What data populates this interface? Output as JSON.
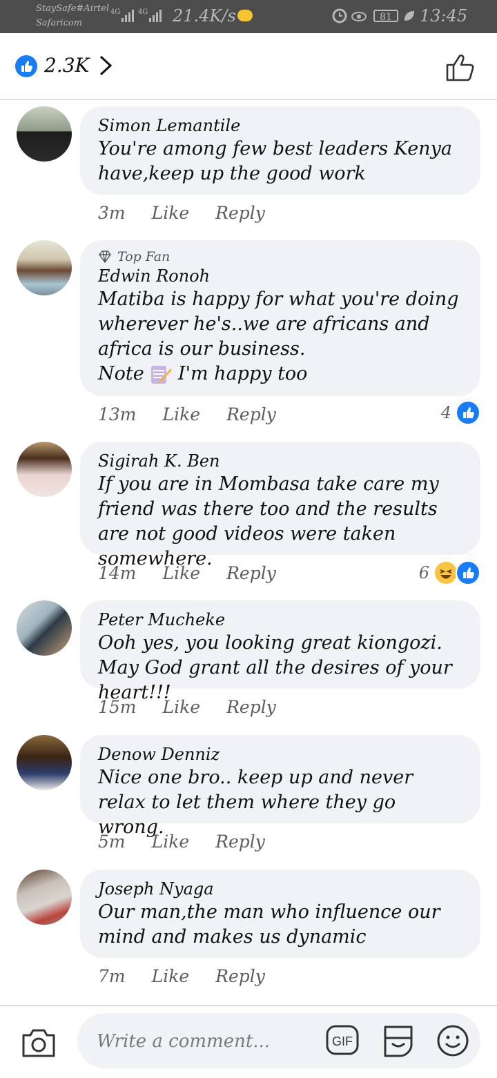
{
  "status_bar": {
    "carrier_line1": "StaySafe#Airtel",
    "carrier_line2": "Safaricom",
    "network1": "4G",
    "network2": "4G",
    "speed": "21.4K/s",
    "battery": "81",
    "time": "13:45"
  },
  "header": {
    "like_count": "2.3K"
  },
  "comments": [
    {
      "author": "Simon Lemantile",
      "badge": "",
      "text": "You're among few best leaders Kenya have,keep up the good work",
      "time": "3m",
      "like": "Like",
      "reply": "Reply",
      "reaction_count": ""
    },
    {
      "author": "Edwin Ronoh",
      "badge": "Top Fan",
      "text_lines": [
        "Matiba is happy for what you're doing wherever he's..we are africans and africa is our business.",
        "Note",
        "I'm happy too"
      ],
      "time": "13m",
      "like": "Like",
      "reply": "Reply",
      "reaction_count": "4"
    },
    {
      "author": "Sigirah K. Ben",
      "badge": "",
      "text": "If you are in Mombasa take care my friend was there too and the results are not good videos were taken somewhere.",
      "time": "14m",
      "like": "Like",
      "reply": "Reply",
      "reaction_count": "6"
    },
    {
      "author": "Peter Mucheke",
      "badge": "",
      "text": "Ooh yes, you looking great kiongozi. May God grant all the desires of your heart!!!",
      "time": "15m",
      "like": "Like",
      "reply": "Reply",
      "reaction_count": ""
    },
    {
      "author": "Denow Denniz",
      "badge": "",
      "text": "Nice one bro.. keep up and never relax to let them where they go wrong.",
      "time": "5m",
      "like": "Like",
      "reply": "Reply",
      "reaction_count": ""
    },
    {
      "author": "Joseph Nyaga",
      "badge": "",
      "text": "Our man,the man who influence our mind and makes us dynamic",
      "time": "7m",
      "like": "Like",
      "reply": "Reply",
      "reaction_count": ""
    }
  ],
  "composer": {
    "placeholder": "Write a comment...",
    "gif_label": "GIF"
  },
  "colors": {
    "accent": "#1a7cf5",
    "bubble": "#f0f2f5",
    "status_bar": "#4d4d4d"
  }
}
